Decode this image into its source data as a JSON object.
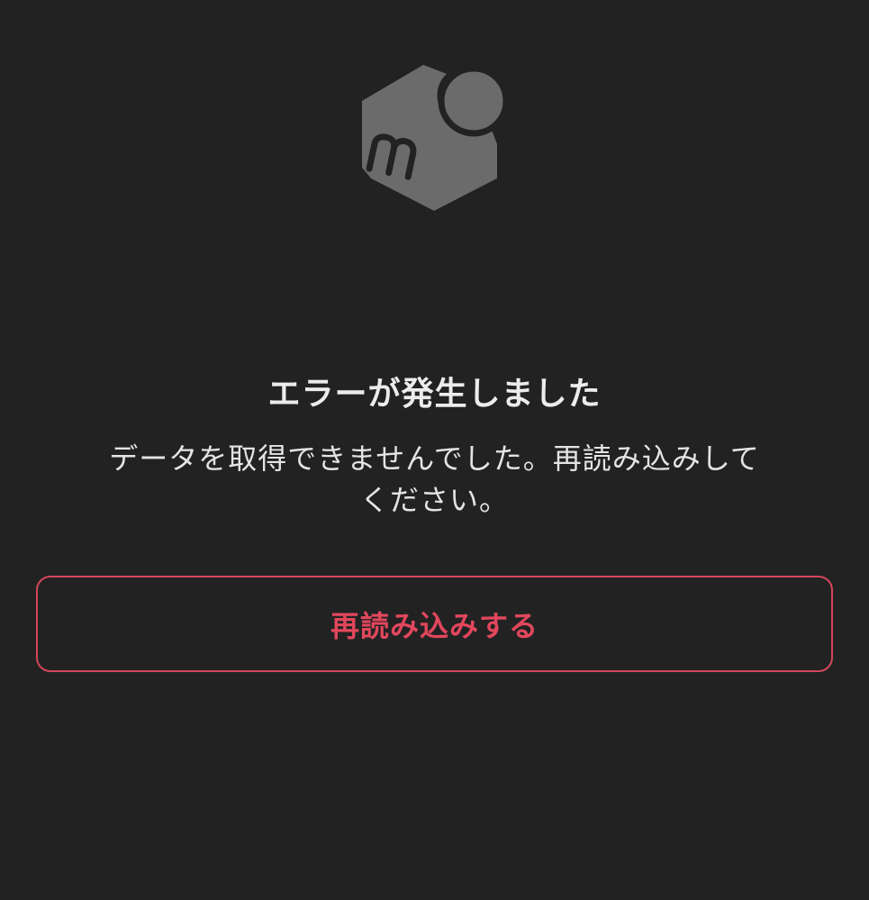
{
  "brand": {
    "logo_icon": "mercari-box-logo-icon",
    "logo_color": "#6b6b6b"
  },
  "error": {
    "title": "エラーが発生しました",
    "message": "データを取得できませんでした。再読み込みしてください。"
  },
  "actions": {
    "reload_label": "再読み込みする"
  },
  "colors": {
    "background": "#222223",
    "accent": "#d5465a",
    "text": "#ececec"
  }
}
